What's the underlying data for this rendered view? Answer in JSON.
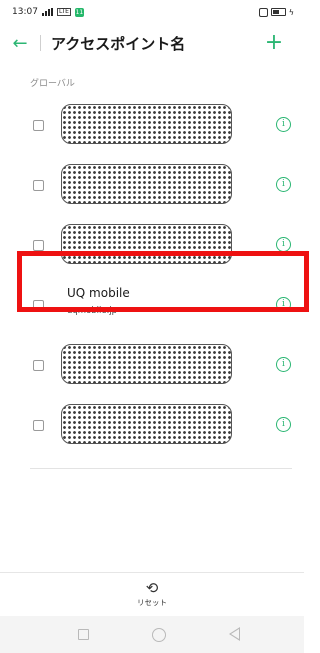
{
  "status_bar": {
    "time": "13:07",
    "network": "LTE",
    "notification": "11"
  },
  "header": {
    "title": "アクセスポイント名",
    "back_icon": "arrow-left-icon",
    "add_icon": "plus-icon",
    "accent_color": "#2bb673"
  },
  "section": {
    "label": "グローバル"
  },
  "apn_list": [
    {
      "redacted": true,
      "selected": false
    },
    {
      "redacted": true,
      "selected": false
    },
    {
      "redacted": true,
      "selected": false
    },
    {
      "redacted": false,
      "selected": false,
      "name": "UQ mobile",
      "apn": "uqmobile.jp",
      "highlighted": true
    },
    {
      "redacted": true,
      "selected": false
    },
    {
      "redacted": true,
      "selected": false
    }
  ],
  "footer": {
    "reset_label": "リセット",
    "reset_icon": "refresh-icon"
  },
  "highlight_color": "#ee1111"
}
